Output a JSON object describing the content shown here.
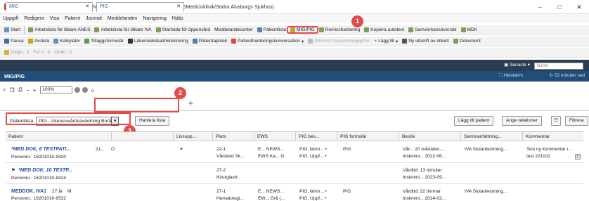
{
  "window": {
    "title": "PowerChart Startsidan för Läkare ANES IVA Cerner Test(Läkare ANES IVA@Medicinklinik/Södra Älvsborgs Sjukhus)",
    "controls": [
      "–",
      "□",
      "✕"
    ]
  },
  "menu": [
    "Uppgift",
    "Redigera",
    "Visa",
    "Patient",
    "Journal",
    "Meddelanden",
    "Navigering",
    "Hjälp"
  ],
  "toolbar1": [
    "Start",
    "Arbetslista för läkare ANES",
    "Arbetslista för läkare IVA",
    "Startsida för öppenvård",
    "Meddelandecenter",
    "Patientlista",
    "MIG/PIG",
    "Remisshantering",
    "Kopiera autotext",
    "Samverkansöversikt",
    "MDK"
  ],
  "toolbar2": [
    "Pausa",
    "Avsluta",
    "Kalkylator",
    "Tilläggsformulär",
    "Läkemedelsadministrering",
    "Patientapotek",
    "Patienthanteringskonversation",
    "Åtkomst till patientuppgifter",
    "Lägg till",
    "Ny utskrift av etikett",
    "Dokument"
  ],
  "toolbar3": [
    "Osign.: 0",
    "Fel n.: 0",
    "Ordin.: 0"
  ],
  "topbar": {
    "recent": "Senaste",
    "search_placeholder": "Namn"
  },
  "view": {
    "title": "MIG/PIG",
    "fullscreen": "Helskärm",
    "refresh": "52 minuter sed"
  },
  "zoom": "100%",
  "tabs": [
    {
      "label": "MIG"
    },
    {
      "label": "PIG"
    }
  ],
  "patientlist": {
    "label": "Patientlista",
    "selected": "PIG - Intensivvårdsavdelning Borås",
    "manage": "Hantera lista"
  },
  "actions": {
    "add_patient": "Lägg till patient",
    "relations": "Ange relationer",
    "filter": "Filtrera"
  },
  "callouts": [
    "1",
    "2",
    "3"
  ],
  "columns": [
    "Patient",
    "",
    "Livsupp...",
    "Plats",
    "EWS",
    "PIG bes...",
    "PIG formulär",
    "Besök",
    "Sammanfattning...",
    "Kommentar"
  ],
  "rows": [
    {
      "name": "*MED DOK, 6 TESTPATI...",
      "age": "21...",
      "sex": "O",
      "pnr": "Personnr.: 16201010-9420",
      "place1": "22-1",
      "place2": "Vårdavd Sk...",
      "ews1": "E... NEWS...",
      "ews2": "EWS Ka... G.",
      "pig1": "PIG, lämn... •",
      "pig2": "PIG, Uppf... •",
      "form": "PIG",
      "visit1": "Vår... 20 månader,...",
      "visit2": "Inskrivni... 2022-06...",
      "summary": "IVA Slutanteckning...",
      "comment1": "Test ny kommentar r...",
      "comment2": "test 221102"
    },
    {
      "name": "*MED DOK, 10 TESTP...",
      "age": "",
      "sex": "",
      "pnr": "Personnr.: 16201010-9424",
      "place1": "27-2",
      "place2": "Kirurgiavd",
      "ews1": "",
      "ews2": "",
      "pig1": "",
      "pig2": "",
      "form": "",
      "visit1": "Vårdtid: 13 minuter",
      "visit2": "Inskrivni... 2023-09...",
      "summary": "",
      "comment1": "",
      "comment2": ""
    },
    {
      "name": "MEDDOK, IVA1",
      "age": "27 år",
      "sex": "M",
      "pnr": "Personnr.: 16201010-9532",
      "place1": "27-1",
      "place2": "Hematologi...",
      "ews1": "E... NEWS...",
      "ews2": "EW... Grå (...",
      "pig1": "PIG, lämn... •",
      "pig2": "PIG, Uppf... •",
      "form": "PIG",
      "visit1": "Vårdtid: 22 timmar",
      "visit2": "Inskrivni... 2024-02...",
      "summary": "IVA Slutanteckning...",
      "comment1": "",
      "comment2": ""
    }
  ]
}
